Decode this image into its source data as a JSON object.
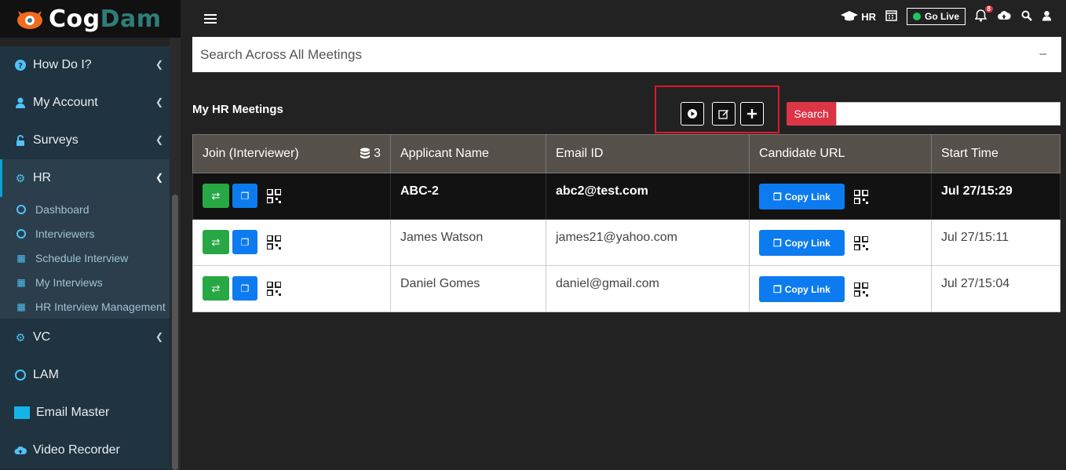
{
  "brand": {
    "part1": "Cog",
    "part2": "Dam"
  },
  "sidebar": {
    "items": [
      {
        "label": "How Do I?",
        "icon": "question-circle-icon"
      },
      {
        "label": "My Account",
        "icon": "user-icon"
      },
      {
        "label": "Surveys",
        "icon": "unlock-icon"
      },
      {
        "label": "HR",
        "icon": "cogs-icon"
      },
      {
        "label": "VC",
        "icon": "cogs-icon"
      },
      {
        "label": "LAM",
        "icon": "circle-icon"
      },
      {
        "label": "Email Master",
        "icon": "square-icon"
      },
      {
        "label": "Video Recorder",
        "icon": "cloud-upload-icon"
      }
    ],
    "hr_sub": [
      {
        "label": "Dashboard",
        "icon": "circle-icon"
      },
      {
        "label": "Interviewers",
        "icon": "circle-icon"
      },
      {
        "label": "Schedule Interview",
        "icon": "calendar-icon"
      },
      {
        "label": "My Interviews",
        "icon": "calendar-icon"
      },
      {
        "label": "HR Interview Management",
        "icon": "calendar-icon"
      }
    ]
  },
  "topbar": {
    "hr_label": "HR",
    "go_live": "Go Live",
    "notification_count": "8"
  },
  "search_across": {
    "placeholder": "Search Across All Meetings",
    "collapse": "−"
  },
  "meetings": {
    "title": "My HR Meetings",
    "search_label": "Search",
    "columns": [
      "Join (Interviewer)",
      "Applicant Name",
      "Email ID",
      "Candidate URL",
      "Start Time"
    ],
    "db_count": "3",
    "copy_label": "Copy Link",
    "rows": [
      {
        "name": "ABC-2",
        "email": "abc2@test.com",
        "time": "Jul 27/15:29"
      },
      {
        "name": "James Watson",
        "email": "james21@yahoo.com",
        "time": "Jul 27/15:11"
      },
      {
        "name": "Daniel Gomes",
        "email": "daniel@gmail.com",
        "time": "Jul 27/15:04"
      }
    ]
  },
  "colors": {
    "accent": "#dc3545",
    "primary": "#0d7bf0",
    "success": "#28a745",
    "sidebar_bg": "#1f3340"
  }
}
